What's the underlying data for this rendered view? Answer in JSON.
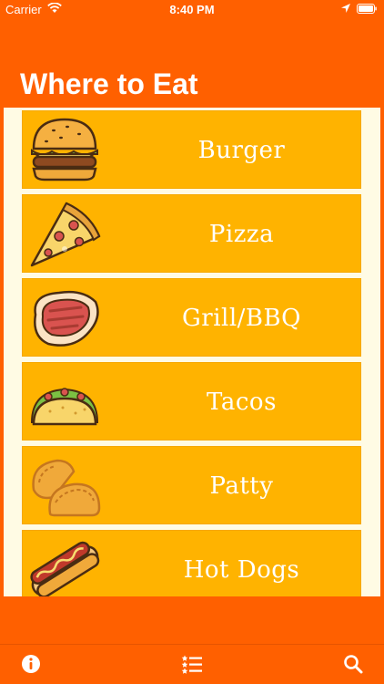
{
  "status_bar": {
    "carrier": "Carrier",
    "time": "8:40 PM",
    "icons": [
      "wifi-icon",
      "location-arrow-icon",
      "battery-icon"
    ]
  },
  "nav": {
    "title": "Where to Eat"
  },
  "categories": [
    {
      "label": "Burger",
      "icon": "burger-icon"
    },
    {
      "label": "Pizza",
      "icon": "pizza-slice-icon"
    },
    {
      "label": "Grill/BBQ",
      "icon": "steak-icon"
    },
    {
      "label": "Tacos",
      "icon": "taco-icon"
    },
    {
      "label": "Patty",
      "icon": "patty-icon"
    },
    {
      "label": "Hot Dogs",
      "icon": "hot-dog-icon"
    }
  ],
  "tab_bar": {
    "icons": [
      "info-icon",
      "ranked-list-icon",
      "search-icon"
    ]
  },
  "colors": {
    "brand": "#ff6000",
    "row": "#ffb300",
    "background": "#fffbe4"
  }
}
